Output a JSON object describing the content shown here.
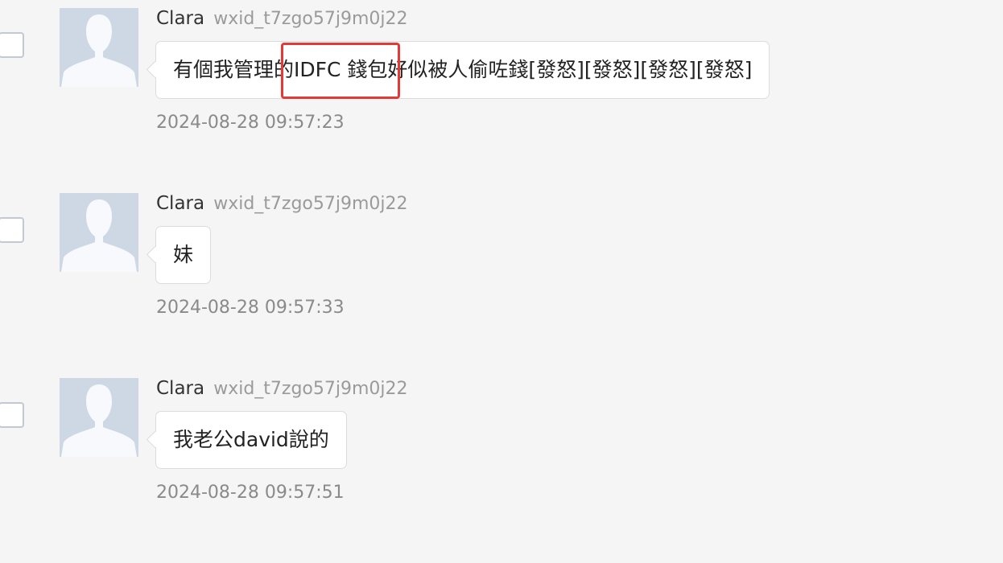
{
  "messages": [
    {
      "sender_name": "Clara",
      "sender_id": "wxid_t7zgo57j9m0j22",
      "text": "有個我管理的IDFC 錢包好似被人偷咗錢[發怒][發怒][發怒][發怒]",
      "timestamp": "2024-08-28 09:57:23"
    },
    {
      "sender_name": "Clara",
      "sender_id": "wxid_t7zgo57j9m0j22",
      "text": "妹",
      "timestamp": "2024-08-28 09:57:33"
    },
    {
      "sender_name": "Clara",
      "sender_id": "wxid_t7zgo57j9m0j22",
      "text": "我老公david說的",
      "timestamp": "2024-08-28 09:57:51"
    }
  ],
  "colors": {
    "page_background": "#f5f5f5",
    "avatar_background": "#ced8e5",
    "avatar_silhouette": "#f7f9fc",
    "highlight": "#e53935"
  },
  "icons": {
    "avatar": "default-user-silhouette-icon"
  }
}
